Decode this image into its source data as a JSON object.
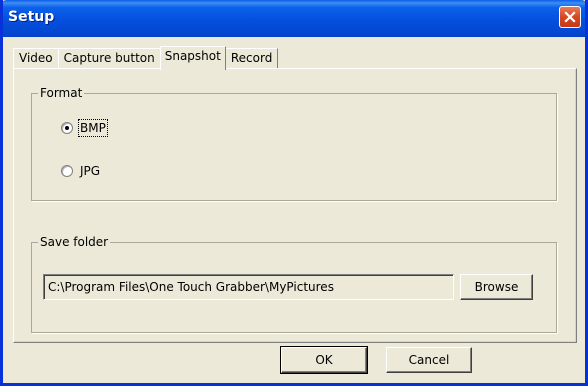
{
  "window": {
    "title": "Setup",
    "close_icon": "close-icon"
  },
  "tabs": [
    {
      "label": "Video",
      "active": false
    },
    {
      "label": "Capture button",
      "active": false
    },
    {
      "label": "Snapshot",
      "active": true
    },
    {
      "label": "Record",
      "active": false
    }
  ],
  "format": {
    "legend": "Format",
    "options": [
      {
        "label": "BMP",
        "selected": true
      },
      {
        "label": "JPG",
        "selected": false
      }
    ]
  },
  "save_folder": {
    "legend": "Save folder",
    "path": "C:\\Program Files\\One Touch Grabber\\MyPictures",
    "browse_label": "Browse"
  },
  "footer": {
    "ok_label": "OK",
    "cancel_label": "Cancel"
  },
  "colors": {
    "title_bar": "#0550dd",
    "close_button": "#d9461f",
    "dialog_face": "#ece9d8"
  }
}
